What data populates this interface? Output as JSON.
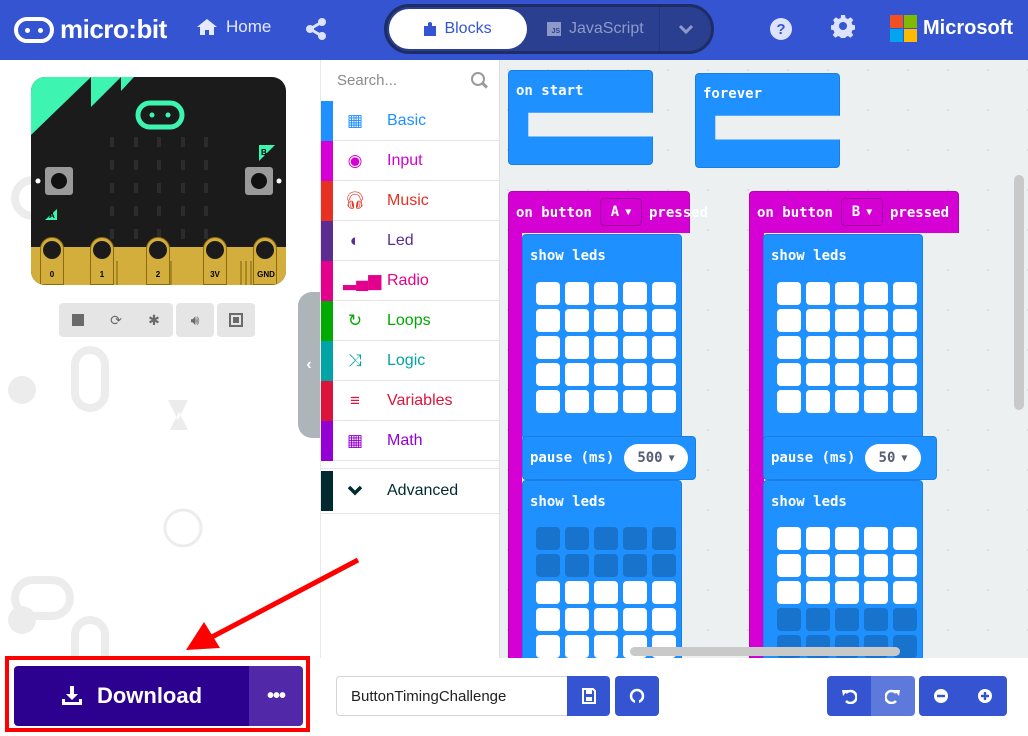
{
  "header": {
    "logo_text": "micro:bit",
    "home_label": "Home",
    "mode_tabs": [
      {
        "label": "Blocks",
        "active": true
      },
      {
        "label": "JavaScript",
        "active": false
      }
    ],
    "js_badge": "JS",
    "brand": "Microsoft",
    "brand_colors": [
      "#f25022",
      "#7fba00",
      "#00a4ef",
      "#ffb900"
    ],
    "help_glyph": "?",
    "accent": "#3454d1"
  },
  "simulator": {
    "pins": [
      "0",
      "1",
      "2",
      "3V",
      "GND"
    ],
    "button_a": "A",
    "button_b": "B",
    "controls": [
      "stop",
      "restart",
      "debug",
      "mute",
      "fullscreen"
    ]
  },
  "toolbox": {
    "search_placeholder": "Search...",
    "categories": [
      {
        "label": "Basic",
        "color": "#1e90ff",
        "icon": "grid-icon"
      },
      {
        "label": "Input",
        "color": "#d400d4",
        "icon": "target-icon"
      },
      {
        "label": "Music",
        "color": "#e63022",
        "icon": "headphones-icon"
      },
      {
        "label": "Led",
        "color": "#5c2d91",
        "icon": "toggle-icon"
      },
      {
        "label": "Radio",
        "color": "#e3008c",
        "icon": "signal-icon"
      },
      {
        "label": "Loops",
        "color": "#00aa00",
        "icon": "refresh-icon"
      },
      {
        "label": "Logic",
        "color": "#00a4a6",
        "icon": "shuffle-icon"
      },
      {
        "label": "Variables",
        "color": "#dc143c",
        "icon": "list-icon"
      },
      {
        "label": "Math",
        "color": "#9400d3",
        "icon": "calculator-icon"
      }
    ],
    "advanced": {
      "label": "Advanced",
      "color": "#012a30"
    }
  },
  "workspace": {
    "on_start": "on start",
    "forever": "forever",
    "events": [
      {
        "prefix": "on button",
        "button": "A",
        "suffix": "pressed",
        "show_leds_1": "show leds",
        "leds_1": [
          [
            1,
            1,
            1,
            1,
            1
          ],
          [
            1,
            1,
            1,
            1,
            1
          ],
          [
            1,
            1,
            1,
            1,
            1
          ],
          [
            1,
            1,
            1,
            1,
            1
          ],
          [
            1,
            1,
            1,
            1,
            1
          ]
        ],
        "pause_label": "pause (ms)",
        "pause_value": "500",
        "show_leds_2": "show leds",
        "leds_2": [
          [
            0,
            0,
            0,
            0,
            0
          ],
          [
            0,
            0,
            0,
            0,
            0
          ],
          [
            1,
            1,
            1,
            1,
            1
          ],
          [
            1,
            1,
            1,
            1,
            1
          ],
          [
            1,
            1,
            1,
            1,
            1
          ]
        ]
      },
      {
        "prefix": "on button",
        "button": "B",
        "suffix": "pressed",
        "show_leds_1": "show leds",
        "leds_1": [
          [
            1,
            1,
            1,
            1,
            1
          ],
          [
            1,
            1,
            1,
            1,
            1
          ],
          [
            1,
            1,
            1,
            1,
            1
          ],
          [
            1,
            1,
            1,
            1,
            1
          ],
          [
            1,
            1,
            1,
            1,
            1
          ]
        ],
        "pause_label": "pause (ms)",
        "pause_value": "50",
        "show_leds_2": "show leds",
        "leds_2": [
          [
            1,
            1,
            1,
            1,
            1
          ],
          [
            1,
            1,
            1,
            1,
            1
          ],
          [
            1,
            1,
            1,
            1,
            1
          ],
          [
            0,
            0,
            0,
            0,
            0
          ],
          [
            0,
            0,
            0,
            0,
            0
          ]
        ]
      }
    ]
  },
  "footer": {
    "download_label": "Download",
    "more_label": "•••",
    "project_name": "ButtonTimingChallenge"
  }
}
